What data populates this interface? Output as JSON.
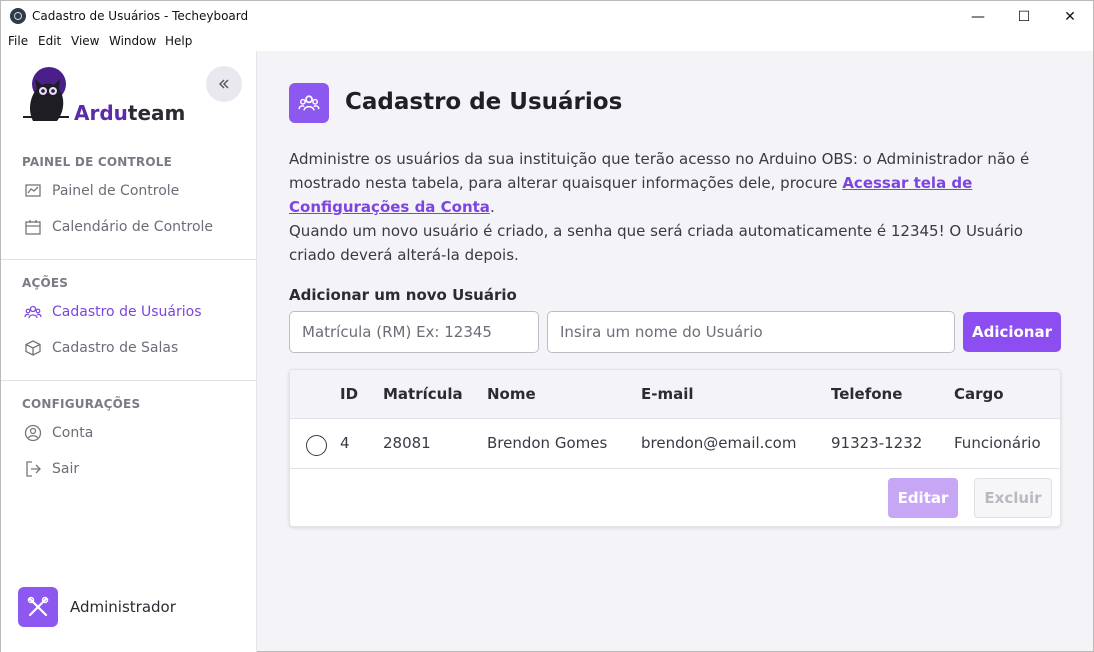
{
  "window": {
    "title": "Cadastro de Usuários - Techeyboard",
    "minimize": "—",
    "maximize": "☐",
    "close": "✕"
  },
  "menu": [
    "File",
    "Edit",
    "View",
    "Window",
    "Help"
  ],
  "sidebar": {
    "logo_prefix": "Ardu",
    "logo_suffix": "team",
    "sections": [
      {
        "title": "PAINEL DE CONTROLE",
        "items": [
          {
            "label": "Painel de Controle",
            "icon": "chart-icon"
          },
          {
            "label": "Calendário de Controle",
            "icon": "calendar-icon"
          }
        ]
      },
      {
        "title": "AÇÕES",
        "items": [
          {
            "label": "Cadastro de Usuários",
            "icon": "users-icon",
            "active": true
          },
          {
            "label": "Cadastro de Salas",
            "icon": "cube-icon"
          }
        ]
      },
      {
        "title": "CONFIGURAÇÕES",
        "items": [
          {
            "label": "Conta",
            "icon": "user-circle-icon"
          },
          {
            "label": "Sair",
            "icon": "logout-icon"
          }
        ]
      }
    ],
    "user_name": "Administrador"
  },
  "main": {
    "title": "Cadastro de Usuários",
    "desc_part1": "Administre os usuários da sua instituição que terão acesso no Arduino OBS: o Administrador não é mostrado nesta tabela, para alterar quaisquer informações dele, procure ",
    "desc_link": "Acessar tela de Configurações da Conta",
    "desc_part2": ".",
    "desc_part3": "Quando um novo usuário é criado, a senha que será criada automaticamente é 12345! O Usuário criado deverá alterá-la depois.",
    "form_label": "Adicionar um novo Usuário",
    "rm_placeholder": "Matrícula (RM) Ex: 12345",
    "name_placeholder": "Insira um nome do Usuário",
    "add_label": "Adicionar",
    "columns": [
      "ID",
      "Matrícula",
      "Nome",
      "E-mail",
      "Telefone",
      "Cargo"
    ],
    "rows": [
      {
        "id": "4",
        "matricula": "28081",
        "nome": "Brendon Gomes",
        "email": "brendon@email.com",
        "telefone": "91323-1232",
        "cargo": "Funcionário"
      }
    ],
    "edit_label": "Editar",
    "delete_label": "Excluir"
  },
  "colors": {
    "accent": "#8c58f0",
    "active_text": "#7c45e0",
    "logo_accent": "#5b2ca8",
    "edit_disabled": "#c7a7f5"
  }
}
